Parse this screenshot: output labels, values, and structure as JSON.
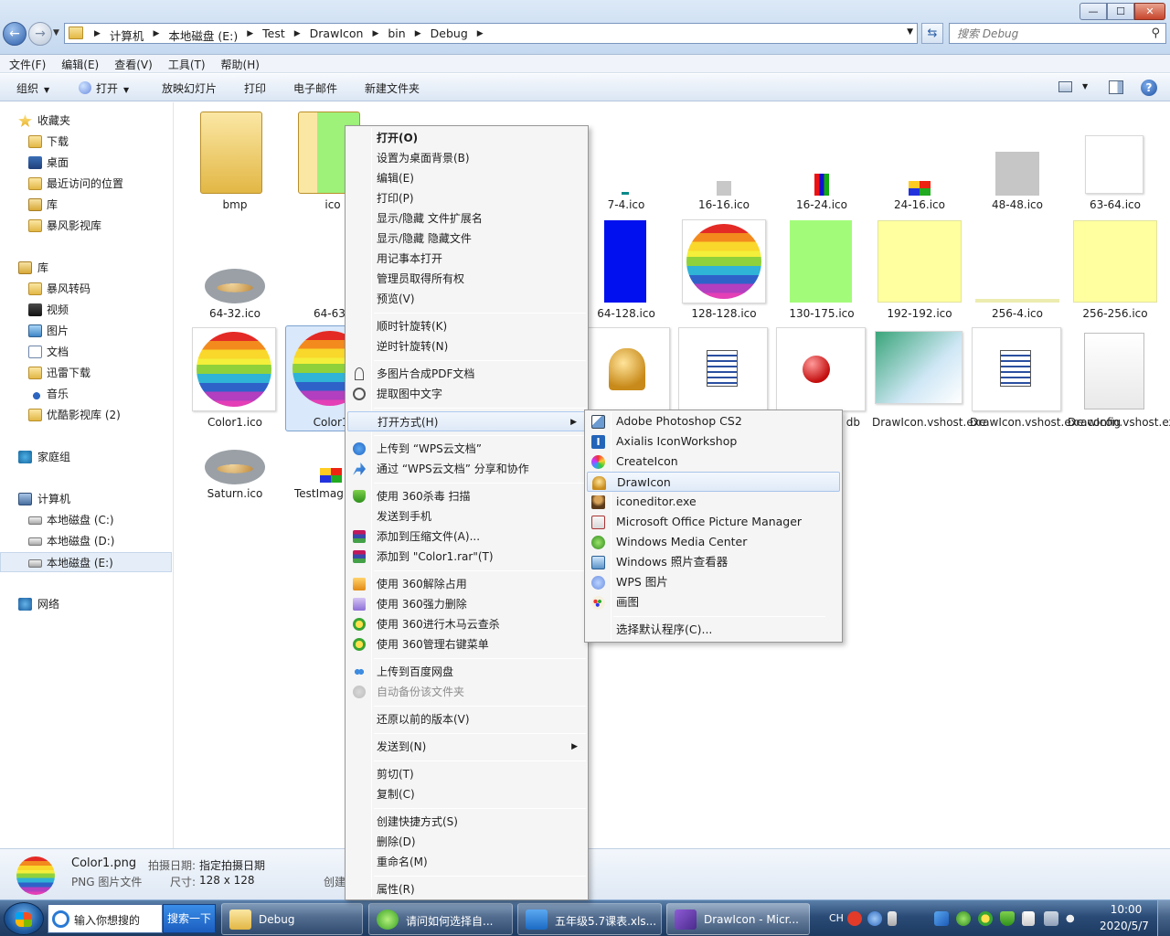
{
  "address": {
    "crumbs": [
      "计算机",
      "本地磁盘 (E:)",
      "Test",
      "DrawIcon",
      "bin",
      "Debug"
    ],
    "search_placeholder": "搜索 Debug"
  },
  "menubar": [
    "文件(F)",
    "编辑(E)",
    "查看(V)",
    "工具(T)",
    "帮助(H)"
  ],
  "commands": {
    "organize": "组织",
    "open": "打开",
    "slideshow": "放映幻灯片",
    "print": "打印",
    "email": "电子邮件",
    "new_folder": "新建文件夹"
  },
  "nav": {
    "favorites": "收藏夹",
    "downloads": "下载",
    "desktop": "桌面",
    "recent": "最近访问的位置",
    "lib_fav": "库",
    "baofeng": "暴风影视库",
    "libraries": "库",
    "baofeng_conv": "暴风转码",
    "videos": "视频",
    "pictures": "图片",
    "documents": "文档",
    "xunlei": "迅雷下载",
    "music": "音乐",
    "youku": "优酷影视库 (2)",
    "homegroup": "家庭组",
    "computer": "计算机",
    "drive_c": "本地磁盘 (C:)",
    "drive_d": "本地磁盘 (D:)",
    "drive_e": "本地磁盘 (E:)",
    "network": "网络"
  },
  "files": {
    "bmp": "bmp",
    "ico": "ico",
    "f7_4": "7-4.ico",
    "f16_16": "16-16.ico",
    "f16_24": "16-24.ico",
    "f24_16": "24-16.ico",
    "f48_48": "48-48.ico",
    "f63_64": "63-64.ico",
    "f64_32": "64-32.ico",
    "f64_63": "64-63.i",
    "f64_128": "64-128.ico",
    "f128_128": "128-128.ico",
    "f130_175": "130-175.ico",
    "f192_192": "192-192.ico",
    "f256_4": "256-4.ico",
    "f256_256": "256-256.ico",
    "color1_ico": "Color1.ico",
    "color1_png": "Color1.",
    "pdb": "db",
    "vshost_exe": "DrawIcon.vshost.exe",
    "vshost_config": "DrawIcon.vshost.exe.config",
    "vshost_manifest": "DrawIcon.vshost.exe.manifest",
    "saturn": "Saturn.ico",
    "testimg": "TestImag"
  },
  "context_menu": {
    "open": "打开(O)",
    "set_wallpaper": "设置为桌面背景(B)",
    "edit": "编辑(E)",
    "print": "打印(P)",
    "toggle_ext": "显示/隐藏 文件扩展名",
    "toggle_hidden": "显示/隐藏 隐藏文件",
    "notepad": "用记事本打开",
    "admin": "管理员取得所有权",
    "preview": "预览(V)",
    "rotate_cw": "顺时针旋转(K)",
    "rotate_ccw": "逆时针旋转(N)",
    "merge_pdf": "多图片合成PDF文档",
    "ocr": "提取图中文字",
    "open_with": "打开方式(H)",
    "wps_upload": "上传到 “WPS云文档”",
    "wps_share": "通过 “WPS云文档” 分享和协作",
    "scan_360": "使用 360杀毒 扫描",
    "send_phone": "发送到手机",
    "add_archive": "添加到压缩文件(A)...",
    "add_rar": "添加到 \"Color1.rar\"(T)",
    "unlock_360": "使用 360解除占用",
    "delete_360": "使用 360强力删除",
    "trojan_360": "使用 360进行木马云查杀",
    "manage_360": "使用 360管理右键菜单",
    "baidu_upload": "上传到百度网盘",
    "auto_backup": "自动备份该文件夹",
    "restore": "还原以前的版本(V)",
    "send_to": "发送到(N)",
    "cut": "剪切(T)",
    "copy": "复制(C)",
    "shortcut": "创建快捷方式(S)",
    "delete": "删除(D)",
    "rename": "重命名(M)",
    "properties": "属性(R)"
  },
  "open_with": {
    "photoshop": "Adobe Photoshop CS2",
    "axialis": "Axialis IconWorkshop",
    "createicon": "CreateIcon",
    "drawicon": "DrawIcon",
    "iconeditor": "iconeditor.exe",
    "mspicture": "Microsoft Office Picture Manager",
    "wmc": "Windows Media Center",
    "photoviewer": "Windows 照片查看器",
    "wps_pic": "WPS 图片",
    "paint": "画图",
    "choose": "选择默认程序(C)..."
  },
  "details": {
    "name": "Color1.png",
    "type": "PNG 图片文件",
    "date_key": "拍摄日期:",
    "date_val": "指定拍摄日期",
    "size_key": "尺寸:",
    "size_val": "128 x 128",
    "created_key": "创建"
  },
  "taskbar": {
    "search_text": "输入你想搜的",
    "search_btn": "搜索一下",
    "task_debug": "Debug",
    "task_qa": "请问如何选择自...",
    "task_excel": "五年级5.7课表.xls...",
    "task_vs": "DrawIcon - Micr...",
    "ime": "CH",
    "time": "10:00",
    "date": "2020/5/7"
  },
  "colors": {
    "accent": "#3a8ee8",
    "selection": "#d9e8fb"
  }
}
